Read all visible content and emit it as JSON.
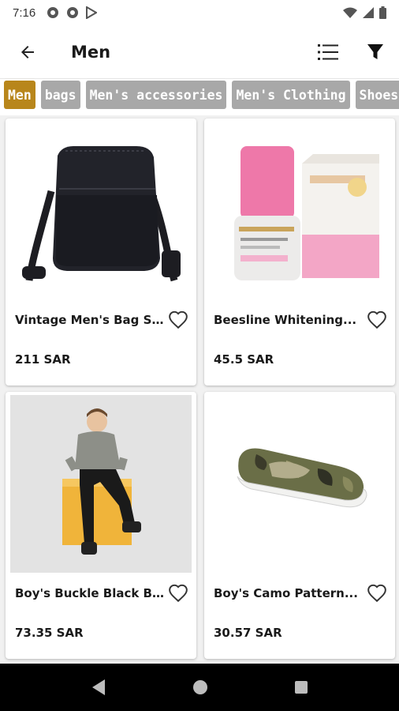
{
  "status_bar": {
    "time": "7:16"
  },
  "header": {
    "title": "Men"
  },
  "categories": [
    {
      "label": "Men",
      "active": true
    },
    {
      "label": "bags",
      "active": false
    },
    {
      "label": "Men's accessories",
      "active": false
    },
    {
      "label": "Men's Clothing",
      "active": false
    },
    {
      "label": "Shoes",
      "active": false
    }
  ],
  "products": [
    {
      "name": "Vintage Men's Bag S...",
      "price": "211 SAR",
      "image": "black-shoulder-bag"
    },
    {
      "name": "Beesline Whitening...",
      "price": "45.5 SAR",
      "image": "pink-roll-on-deodorant"
    },
    {
      "name": "Boy's Buckle Black B...",
      "price": "73.35 SAR",
      "image": "boy-sitting-on-yellow-block"
    },
    {
      "name": "Boy's Camo Pattern...",
      "price": "30.57 SAR",
      "image": "camo-slip-on-shoe"
    }
  ],
  "colors": {
    "accent": "#b8861b",
    "chip_inactive": "#a8a8a8",
    "nav_bar": "#000000"
  },
  "icons": [
    "back-arrow-icon",
    "list-view-icon",
    "filter-icon",
    "heart-icon",
    "nav-back-icon",
    "nav-home-icon",
    "nav-recents-icon"
  ]
}
